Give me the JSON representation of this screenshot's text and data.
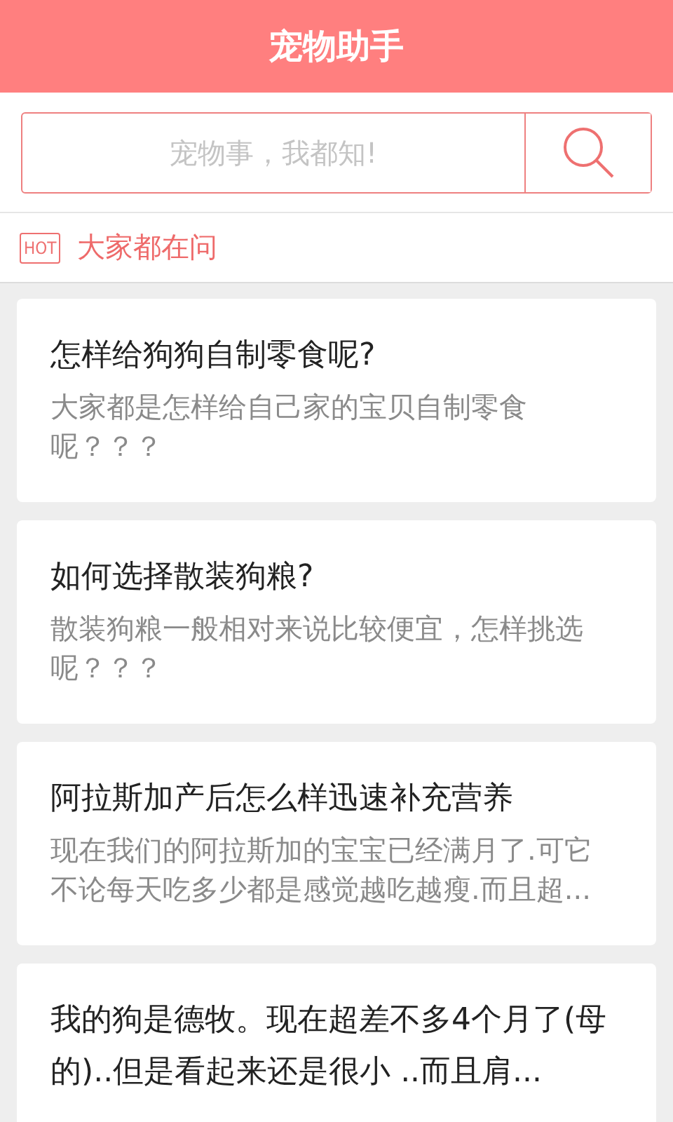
{
  "header": {
    "title": "宠物助手"
  },
  "search": {
    "placeholder": "宠物事，我都知!"
  },
  "section": {
    "badge": "HOT",
    "title": "大家都在问"
  },
  "questions": [
    {
      "title": "怎样给狗狗自制零食呢?",
      "summary": "大家都是怎样给自己家的宝贝自制零食呢？？？"
    },
    {
      "title": "如何选择散装狗粮?",
      "summary": "散装狗粮一般相对来说比较便宜，怎样挑选呢？？？"
    },
    {
      "title": "阿拉斯加产后怎么样迅速补充营养",
      "summary": "现在我们的阿拉斯加的宝宝已经满月了.可它不论每天吃多少都是感觉越吃越瘦.而且超..."
    },
    {
      "title": "我的狗是德牧。现在超差不多4个月了(母的)..但是看起来还是很小 ..而且肩..."
    }
  ]
}
